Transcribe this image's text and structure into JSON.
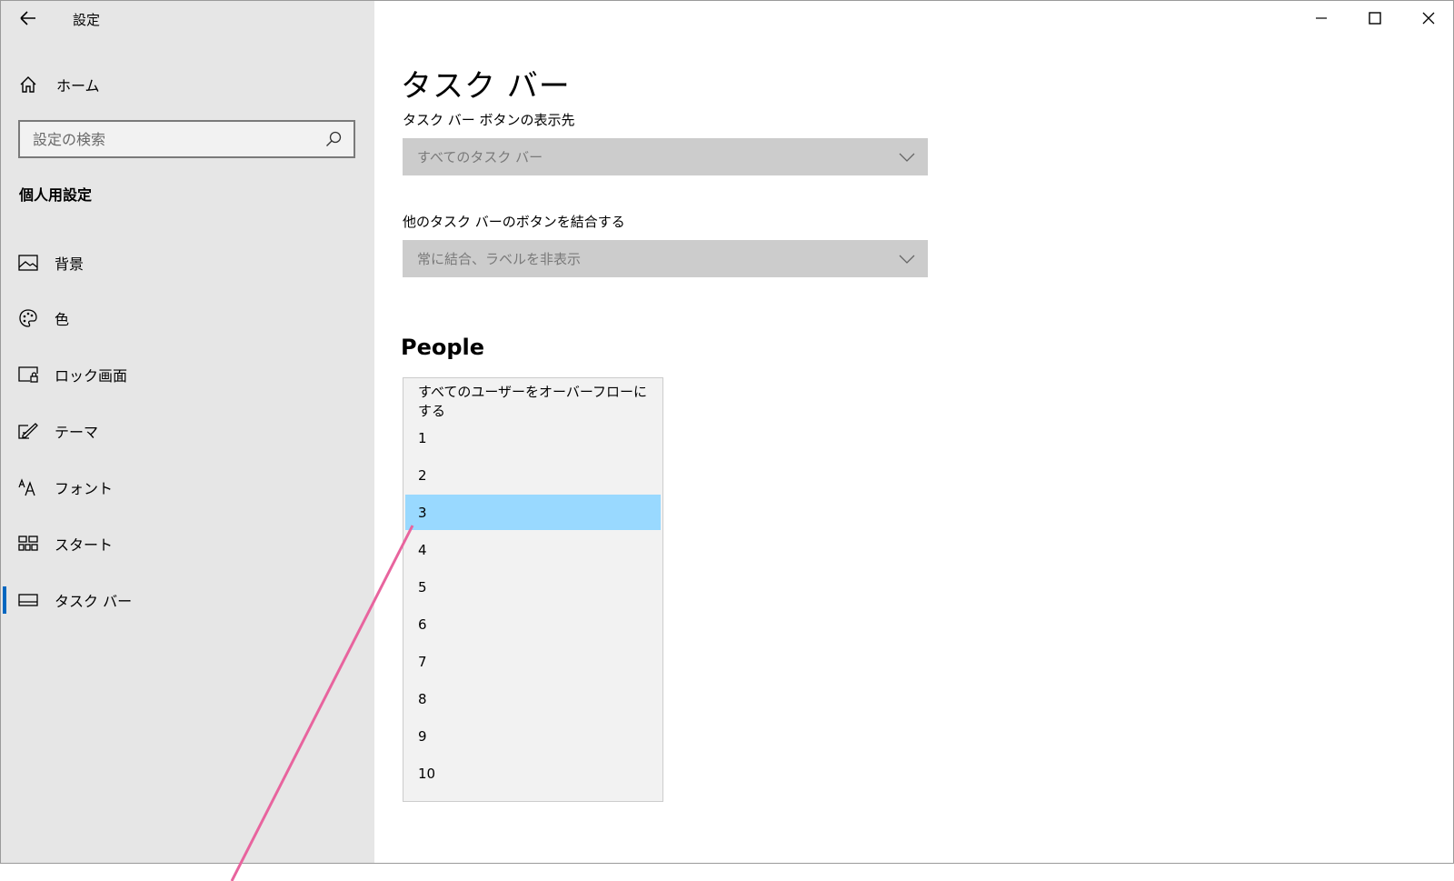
{
  "window": {
    "app_title": "設定",
    "controls": {
      "minimize": "minimize-icon",
      "maximize": "maximize-icon",
      "close": "close-icon"
    }
  },
  "sidebar": {
    "home_label": "ホーム",
    "search_placeholder": "設定の検索",
    "section_title": "個人用設定",
    "items": [
      {
        "label": "背景",
        "icon": "picture-icon"
      },
      {
        "label": "色",
        "icon": "palette-icon"
      },
      {
        "label": "ロック画面",
        "icon": "lock-screen-icon"
      },
      {
        "label": "テーマ",
        "icon": "theme-icon"
      },
      {
        "label": "フォント",
        "icon": "font-icon"
      },
      {
        "label": "スタート",
        "icon": "start-icon"
      },
      {
        "label": "タスク バー",
        "icon": "taskbar-icon",
        "selected": true
      }
    ]
  },
  "main": {
    "page_title": "タスク バー",
    "buttons_display": {
      "label": "タスク バー ボタンの表示先",
      "value": "すべてのタスク バー"
    },
    "combine_buttons": {
      "label": "他のタスク バーのボタンを結合する",
      "value": "常に結合、ラベルを非表示"
    },
    "people": {
      "title": "People",
      "options": [
        "すべてのユーザーをオーバーフローにする",
        "1",
        "2",
        "3",
        "4",
        "5",
        "6",
        "7",
        "8",
        "9",
        "10"
      ],
      "selected": "3"
    }
  },
  "colors": {
    "sidebar_bg": "#e6e6e6",
    "selected_option": "#99d9ff",
    "accent": "#0067c0",
    "callout_line": "#e8649e"
  }
}
